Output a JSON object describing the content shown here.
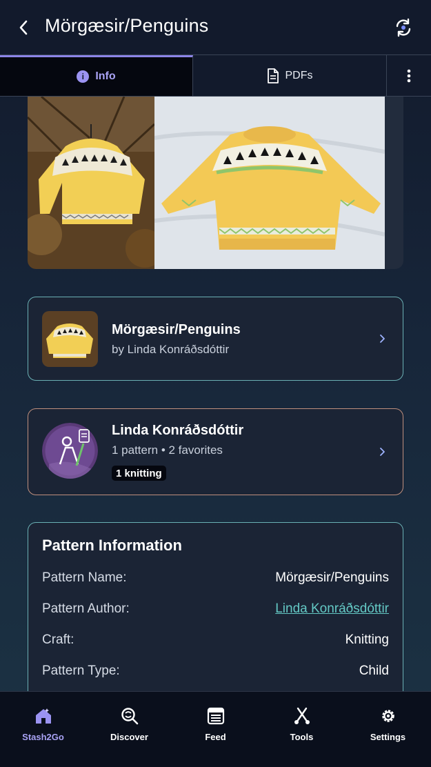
{
  "header": {
    "title": "Mörgæsir/Penguins",
    "back_icon": "chevron-left-icon",
    "sync_icon": "sync-icon"
  },
  "tabs": [
    {
      "label": "Info",
      "icon": "info-icon",
      "active": true
    },
    {
      "label": "PDFs",
      "icon": "document-icon",
      "active": false
    },
    {
      "label": "",
      "icon": "more-vertical-icon",
      "active": false
    }
  ],
  "pattern_card": {
    "title": "Mörgæsir/Penguins",
    "subtitle": "by Linda Konráðsdóttir"
  },
  "designer_card": {
    "name": "Linda Konráðsdóttir",
    "stats": "1 pattern • 2 favorites",
    "badge": "1 knitting"
  },
  "pattern_info": {
    "heading": "Pattern Information",
    "rows": [
      {
        "label": "Pattern Name:",
        "value": "Mörgæsir/Penguins",
        "link": false
      },
      {
        "label": "Pattern Author:",
        "value": "Linda Konráðsdóttir",
        "link": true
      },
      {
        "label": "Craft:",
        "value": "Knitting",
        "link": false
      },
      {
        "label": "Pattern Type:",
        "value": "Child",
        "link": false
      }
    ]
  },
  "bottom_nav": [
    {
      "label": "Stash2Go",
      "icon": "home-icon",
      "active": true
    },
    {
      "label": "Discover",
      "icon": "discover-icon",
      "active": false
    },
    {
      "label": "Feed",
      "icon": "feed-icon",
      "active": false
    },
    {
      "label": "Tools",
      "icon": "tools-icon",
      "active": false
    },
    {
      "label": "Settings",
      "icon": "gear-icon",
      "active": false
    }
  ],
  "colors": {
    "accent": "#a9a3f5",
    "link": "#64c9c5",
    "pattern_border": "#6bb1b5",
    "designer_border": "#c0907e"
  }
}
